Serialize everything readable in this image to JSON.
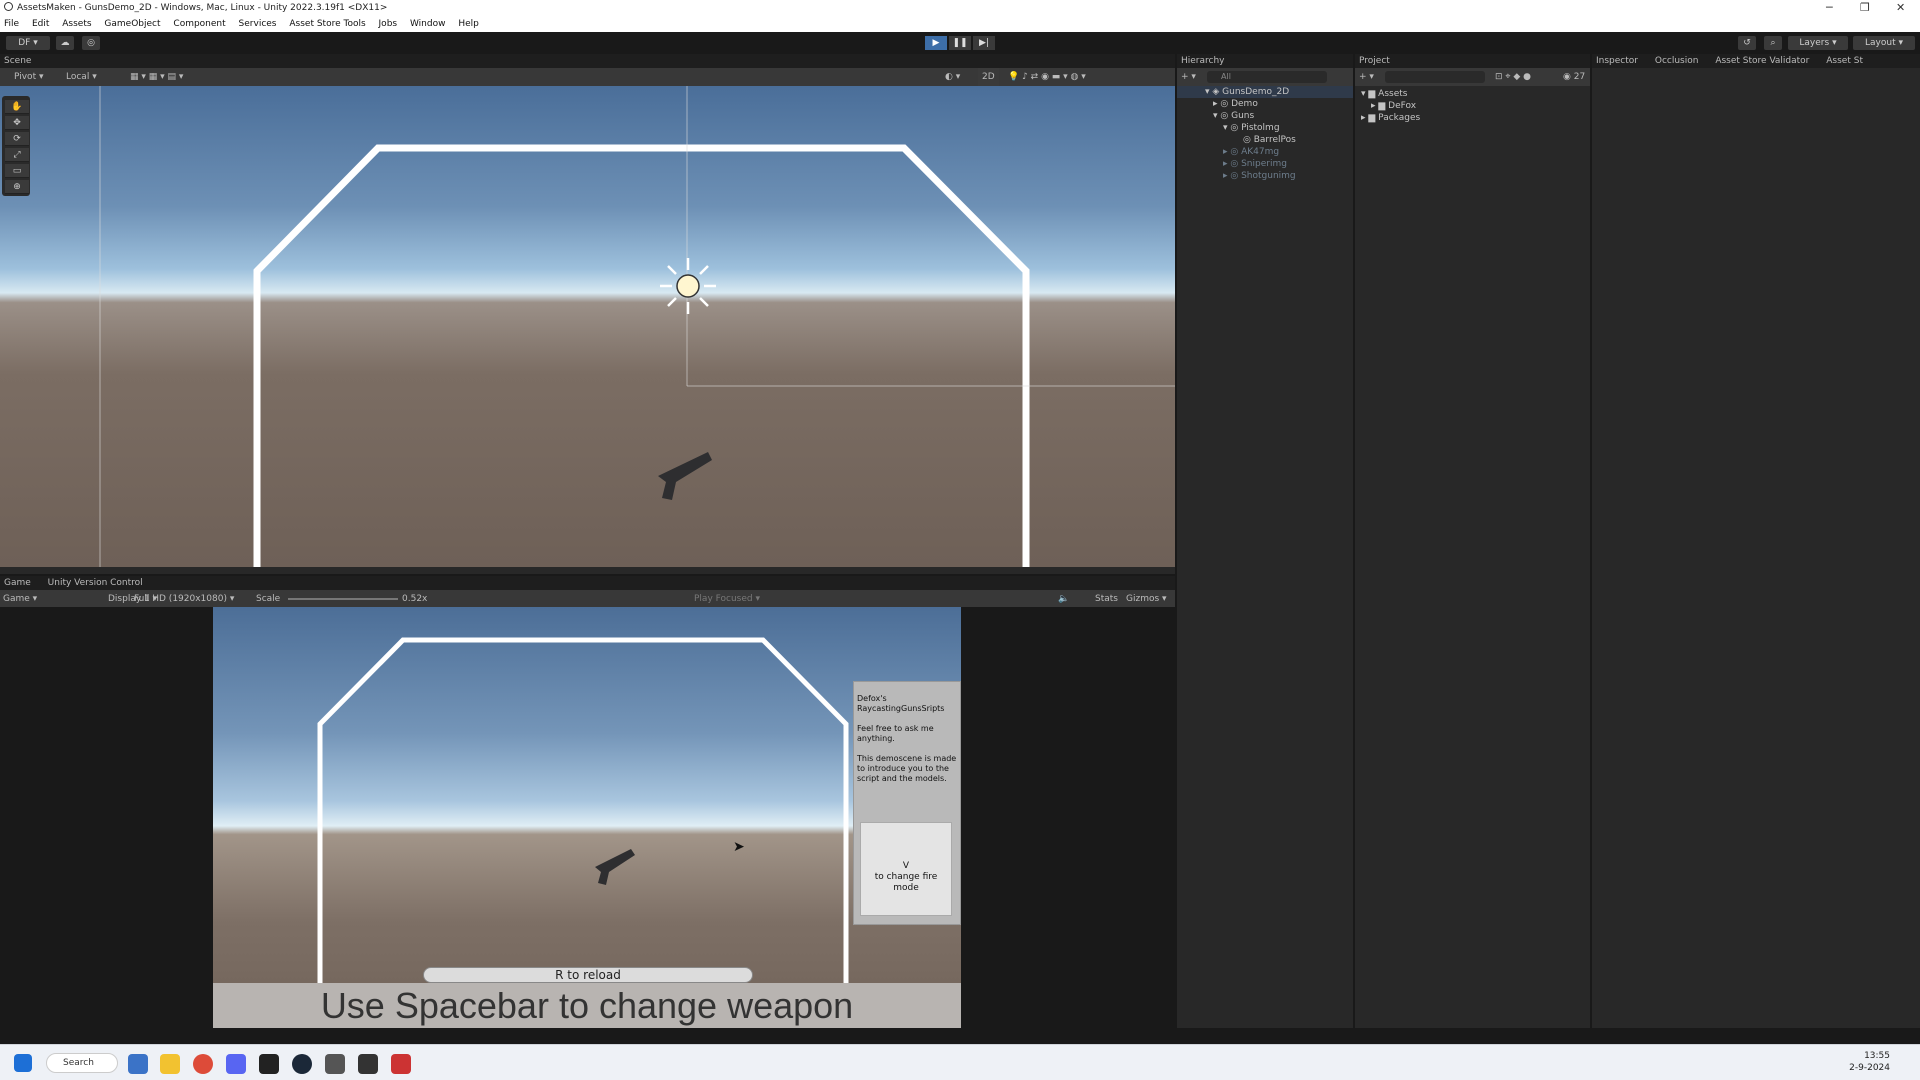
{
  "titlebar": {
    "title": "AssetsMaken - GunsDemo_2D - Windows, Mac, Linux - Unity 2022.3.19f1 <DX11>"
  },
  "menu": [
    "File",
    "Edit",
    "Assets",
    "GameObject",
    "Component",
    "Services",
    "Asset Store Tools",
    "Jobs",
    "Window",
    "Help"
  ],
  "toolbar": {
    "account": "DF",
    "layers": "Layers",
    "layout": "Layout"
  },
  "scene": {
    "tab": "Scene",
    "pivot": "Pivot",
    "local": "Local",
    "mode2d": "2D"
  },
  "game": {
    "tab": "Game",
    "vcs_tab": "Unity Version Control",
    "mode": "Game",
    "display": "Display 1",
    "resolution": "Full HD (1920x1080)",
    "scale_label": "Scale",
    "scale": "0.52x",
    "play_focused": "Play Focused",
    "stats": "Stats",
    "gizmos": "Gizmos"
  },
  "ingame": {
    "reload": "R to reload",
    "change_weapon": "Use Spacebar to change weapon",
    "info_title_1": "Defox's",
    "info_title_2": "RaycastingGunsSripts",
    "info_line_1": "Feel free to ask me",
    "info_line_2": "anything.",
    "info_line_3": "This demoscene is made",
    "info_line_4": "to introduce you to the",
    "info_line_5": "script and the models.",
    "fire_key": "V",
    "fire_text": "to change fire mode"
  },
  "hierarchy": {
    "tab": "Hierarchy",
    "search_placeholder": "All",
    "items": [
      {
        "label": "GunsDemo_2D"
      },
      {
        "label": "Demo"
      },
      {
        "label": "Guns"
      },
      {
        "label": "Pistolmg"
      },
      {
        "label": "BarrelPos"
      },
      {
        "label": "AK47mg"
      },
      {
        "label": "Sniperimg"
      },
      {
        "label": "Shotgunimg"
      }
    ]
  },
  "project": {
    "tab": "Project",
    "count": "27",
    "items": [
      {
        "label": "Assets"
      },
      {
        "label": "DeFox"
      },
      {
        "label": "Packages"
      }
    ]
  },
  "inspector": {
    "tabs": [
      "Inspector",
      "Occlusion",
      "Asset Store Validator",
      "Asset St"
    ]
  },
  "taskbar": {
    "search": "Search",
    "time": "13:55",
    "date": "2-9-2024"
  }
}
